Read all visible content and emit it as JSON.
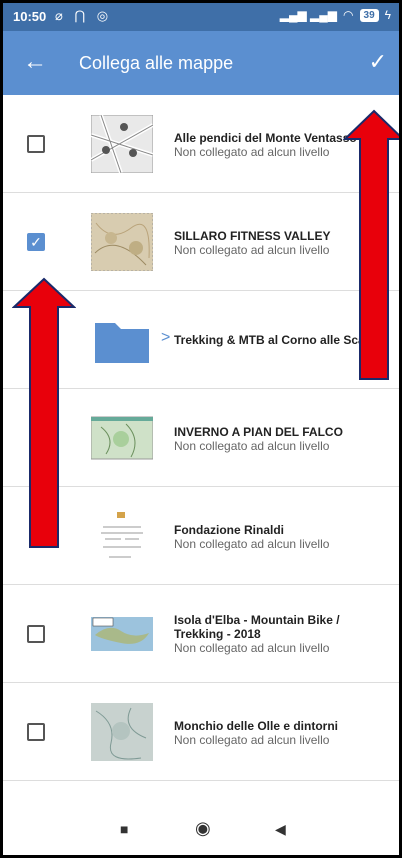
{
  "status": {
    "time": "10:50",
    "icons": "⌀ ⋂ ◎",
    "battery": "39"
  },
  "appbar": {
    "title": "Collega alle mappe"
  },
  "items": [
    {
      "title": "Alle pendici del Monte Ventasso",
      "subtitle": "Non collegato ad alcun livello",
      "checked": false
    },
    {
      "title": "SILLARO FITNESS VALLEY",
      "subtitle": "Non collegato ad alcun livello",
      "checked": true
    },
    {
      "folder": "Trekking & MTB al Corno alle Scale"
    },
    {
      "title": "INVERNO A PIAN DEL FALCO",
      "subtitle": "Non collegato ad alcun livello"
    },
    {
      "title": "Fondazione Rinaldi",
      "subtitle": "Non collegato ad alcun livello"
    },
    {
      "title": "Isola d'Elba -  Mountain Bike / Trekking - 2018",
      "subtitle": "Non collegato ad alcun livello",
      "checked": false
    },
    {
      "title": "Monchio delle Olle e dintorni",
      "subtitle": "Non collegato ad alcun livello",
      "checked": false
    }
  ],
  "colors": {
    "appbar": "#5b8fd0",
    "statusbar": "#3f6fa8",
    "arrow": "#e8000b"
  }
}
